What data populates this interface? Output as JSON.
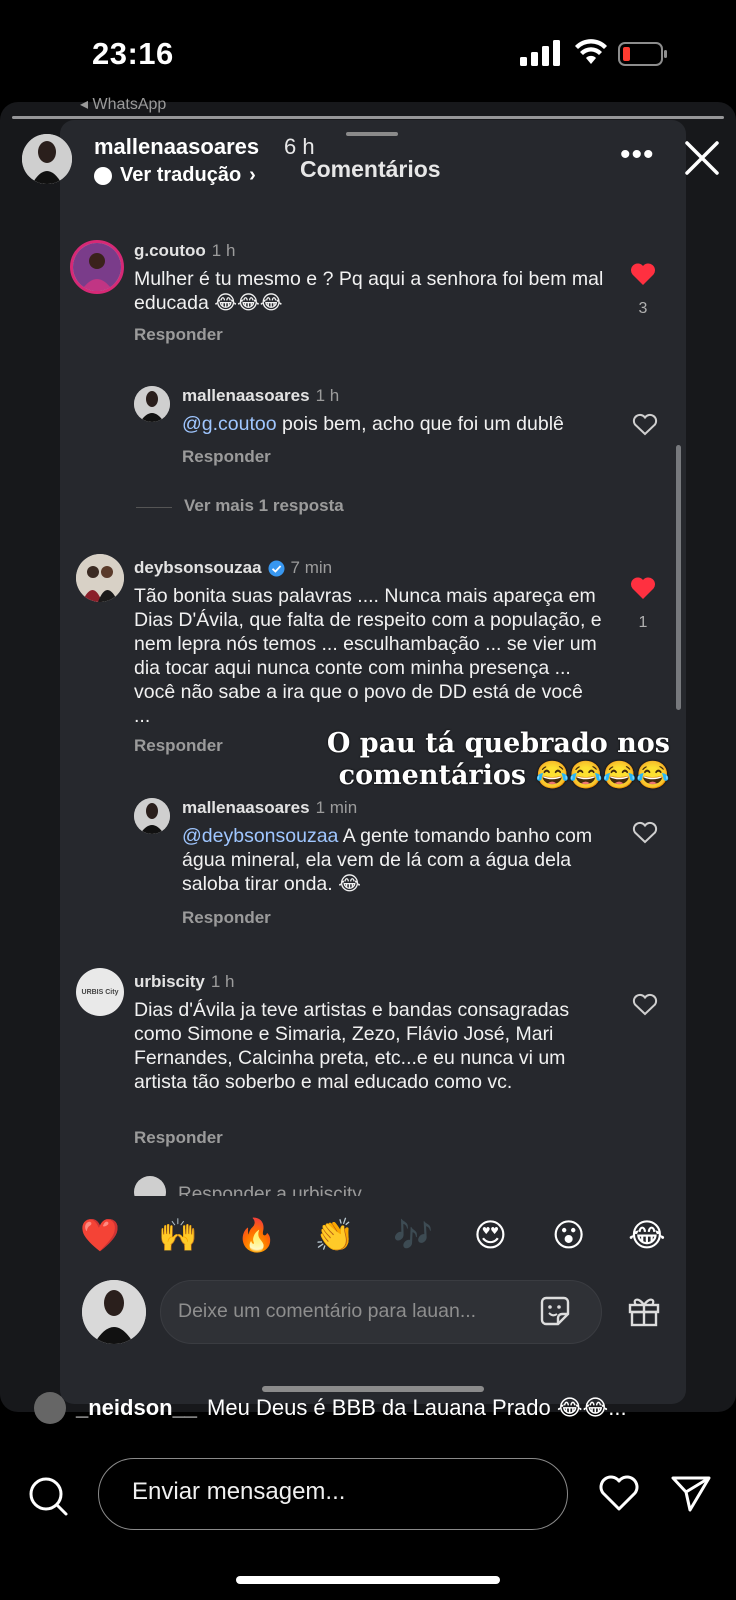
{
  "status_bar": {
    "time": "23:16"
  },
  "story": {
    "source_label": "◂ WhatsApp",
    "username": "mallenaasoares",
    "time_ago": "6 h",
    "translate_label": "Ver tradução",
    "overlay_text_line1": "O pau tá quebrado nos",
    "overlay_text_line2": "comentários 😂😂😂😂"
  },
  "comments_sheet": {
    "title": "Comentários",
    "comments": [
      {
        "user": "g.coutoo",
        "time": "1 h",
        "text": "Mulher é tu mesmo e ? Pq aqui a senhora foi bem mal educada 😂😂😂",
        "likes": "3",
        "reply_label": "Responder",
        "replies": [
          {
            "user": "mallenaasoares",
            "time": "1 h",
            "mention": "@g.coutoo",
            "text": " pois bem, acho que foi um dublê",
            "reply_label": "Responder"
          }
        ],
        "more_replies": "Ver mais 1 resposta"
      },
      {
        "user": "deybsonsouzaa",
        "time": "7 min",
        "text": "Tão bonita suas palavras .... Nunca mais apareça em Dias D'Ávila, que falta de respeito com a população, e nem lepra nós temos ... esculhambação ... se vier um dia tocar aqui nunca conte com minha presença ... você não sabe a ira que o povo de DD está de você ...",
        "likes": "1",
        "reply_label": "Responder",
        "replies": [
          {
            "user": "mallenaasoares",
            "time": "1 min",
            "mention": "@deybsonsouzaa",
            "text": " A gente tomando banho com água mineral, ela vem de lá com a água dela saloba tirar onda. 😂",
            "reply_label": "Responder"
          }
        ]
      },
      {
        "user": "urbiscity",
        "time": "1 h",
        "text": "Dias d'Ávila ja teve artistas e bandas consagradas como Simone e Simaria, Zezo, Flávio José, Mari Fernandes, Calcinha preta, etc...e eu nunca vi um artista tão soberbo e mal educado como vc.",
        "reply_label": "Responder",
        "avatar_text": "URBIS City",
        "partial_reply_prompt": "Responder a urbiscity"
      }
    ],
    "emoji_bar": [
      "❤️",
      "🙌",
      "🔥",
      "👏",
      "🎶",
      "😍",
      "😮",
      "😂"
    ],
    "comment_placeholder": "Deixe um comentário para lauan..."
  },
  "bottom": {
    "latest_comment_user": "_neidson__",
    "latest_comment_text": "Meu Deus é BBB da Lauana Prado 😂😂...",
    "message_placeholder": "Enviar mensagem..."
  },
  "colors": {
    "like_red": "#ff3040",
    "mention_blue": "#9fc6ff",
    "verified_blue": "#3897f0"
  }
}
